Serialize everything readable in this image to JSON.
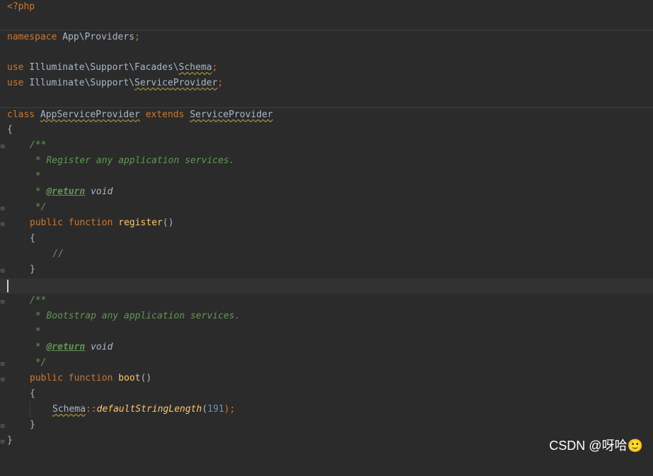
{
  "code": {
    "open_tag": "<?php",
    "namespace": {
      "keyword": "namespace",
      "name": "App\\Providers",
      "end": ";"
    },
    "use1": {
      "keyword": "use",
      "path": "Illuminate\\Support\\Facades\\",
      "cls": "Schema",
      "end": ";"
    },
    "use2": {
      "keyword": "use",
      "path": "Illuminate\\Support\\",
      "cls": "ServiceProvider",
      "end": ";"
    },
    "class_decl": {
      "keyword": "class",
      "name": "AppServiceProvider",
      "extends": "extends",
      "parent": "ServiceProvider"
    },
    "brace_open": "{",
    "brace_close": "}",
    "doc1": {
      "open": "/**",
      "text": " * Register any application services.",
      "star": " *",
      "tag_prefix": " * ",
      "tag": "@return",
      "type": "void",
      "close": " */"
    },
    "register": {
      "public": "public",
      "function": "function",
      "name": "register",
      "parens": "()"
    },
    "inner_comment": "//",
    "doc2": {
      "open": "/**",
      "text": " * Bootstrap any application services.",
      "star": " *",
      "tag_prefix": " * ",
      "tag": "@return",
      "type": "void",
      "close": " */"
    },
    "boot": {
      "public": "public",
      "function": "function",
      "name": "boot",
      "parens": "()"
    },
    "schema_call": {
      "cls": "Schema",
      "op": "::",
      "method": "defaultStringLength",
      "open": "(",
      "arg": "191",
      "close": ");"
    }
  },
  "watermark": "CSDN @呀哈🙂",
  "colors": {
    "background": "#2b2b2b",
    "keyword": "#cc7832",
    "function": "#ffc66d",
    "doc": "#629755",
    "number": "#6897bb",
    "text": "#a9b7c6"
  }
}
